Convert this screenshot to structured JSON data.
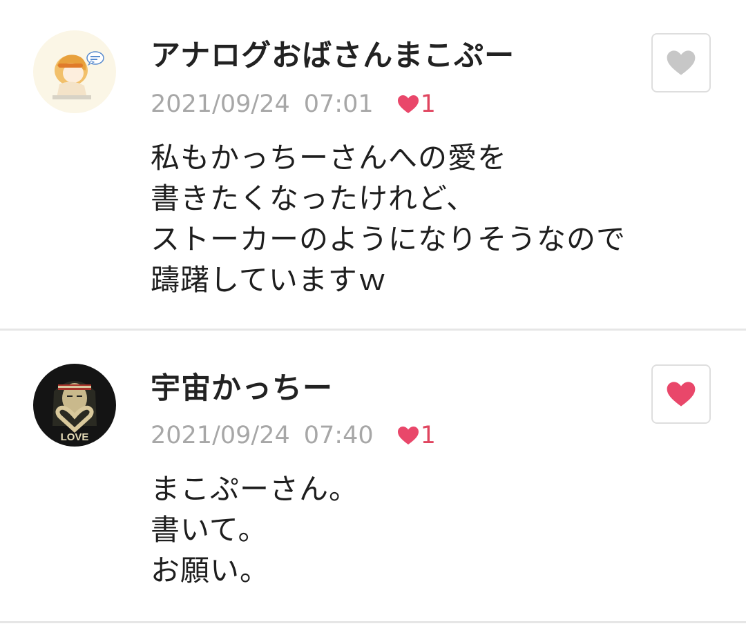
{
  "colors": {
    "like_active": "#e9476a",
    "like_inactive": "#c7c7c7",
    "meta_text": "#a7a7a7",
    "divider": "#e6e6e6"
  },
  "comments": [
    {
      "username": "アナログおばさんまこぷー",
      "date": "2021/09/24",
      "time": "07:01",
      "likes": "1",
      "lines": [
        "私もかっちーさんへの愛を",
        "書きたくなったけれど、",
        "ストーカーのようになりそうなので",
        "躊躇していますｗ"
      ],
      "avatar_icon": "illustrated-woman-avatar",
      "like_button_icon": "heart-icon",
      "liked": false
    },
    {
      "username": "宇宙かっちー",
      "date": "2021/09/24",
      "time": "07:40",
      "likes": "1",
      "lines": [
        "まこぷーさん。",
        "書いて。",
        "お願い。"
      ],
      "avatar_icon": "heart-hands-love-avatar",
      "avatar_text": "LOVE",
      "like_button_icon": "heart-icon",
      "liked": true
    }
  ]
}
